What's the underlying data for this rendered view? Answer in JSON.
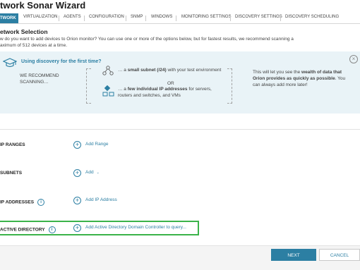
{
  "wizard": {
    "title": "twork Sonar Wizard"
  },
  "tabs": [
    {
      "label": "TWORK",
      "active": true
    },
    {
      "label": "VIRTUALIZATION"
    },
    {
      "label": "AGENTS"
    },
    {
      "label": "CONFIGURATION"
    },
    {
      "label": "SNMP"
    },
    {
      "label": "WINDOWS"
    },
    {
      "label": "MONITORING SETTINGS"
    },
    {
      "label": "DISCOVERY SETTINGS"
    },
    {
      "label": "DISCOVERY SCHEDULING"
    }
  ],
  "section": {
    "title": "etwork Selection",
    "desc_line1": "w do you want to add devices to Orion monitor? You can use one or more of the options below, but for fastest results, we recommend scanning a",
    "desc_line2": "aximum of 512 devices at a time."
  },
  "banner": {
    "title": "Using discovery for the first time?",
    "recommend": "WE RECOMMEND SCANNING…",
    "option1_pre": "… a ",
    "option1_bold": "small subnet (/24)",
    "option1_post": " with your test environment",
    "or": "OR",
    "option2_pre": "… a ",
    "option2_bold": "few individual IP addresses",
    "option2_post": " for servers, routers and switches, and VMs",
    "right_pre": "This will let you see the ",
    "right_bold": "wealth of data that Orion provides as quickly as possible",
    "right_post": ". You can always add more later!"
  },
  "rows": {
    "ip_ranges": {
      "label": "IP RANGES",
      "action": "Add Range"
    },
    "subnets": {
      "label": "SUBNETS",
      "action": "Add"
    },
    "ip_addresses": {
      "label": "IP ADDRESSES",
      "action": "Add IP Address"
    },
    "active_directory": {
      "label": "ACTIVE DIRECTORY",
      "action": "Add Active Directory Domain Controller to query..."
    }
  },
  "footer": {
    "next": "NEXT",
    "cancel": "CANCEL"
  },
  "colors": {
    "accent": "#2c7fa3",
    "highlight": "#3bb34a",
    "banner_bg": "#e9f3f7"
  }
}
